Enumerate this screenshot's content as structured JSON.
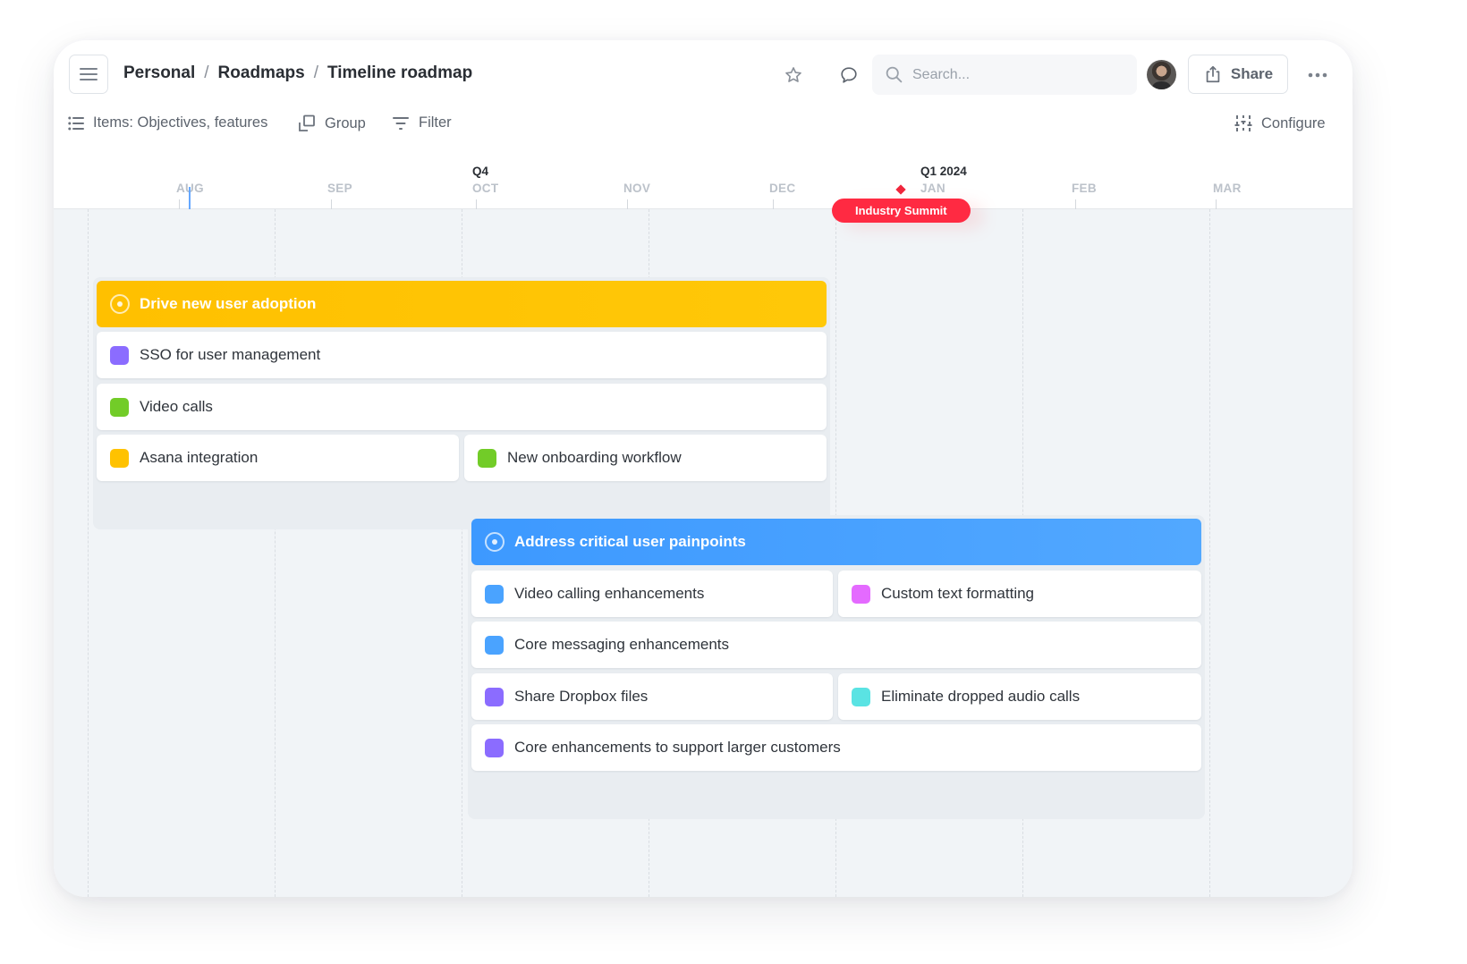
{
  "breadcrumb": [
    "Personal",
    "Roadmaps",
    "Timeline roadmap"
  ],
  "breadcrumb_separator": "/",
  "search": {
    "placeholder": "Search..."
  },
  "header": {
    "share_label": "Share"
  },
  "toolbar": {
    "items_label": "Items: Objectives, features",
    "group_label": "Group",
    "filter_label": "Filter",
    "configure_label": "Configure"
  },
  "timeline": {
    "quarters": [
      {
        "label": "Q4",
        "starts_at": "OCT"
      },
      {
        "label": "Q1 2024",
        "starts_at": "JAN"
      }
    ],
    "months": [
      "AUG",
      "SEP",
      "OCT",
      "NOV",
      "DEC",
      "JAN",
      "FEB",
      "MAR"
    ],
    "today_marker": "AUG",
    "milestones": [
      {
        "label": "Industry Summit",
        "color": "#ff2a42"
      }
    ]
  },
  "colors": {
    "objective_yellow": "#ffc200",
    "objective_blue": "#4aa3ff",
    "purple": "#8b6cff",
    "green": "#72cc28",
    "yellow": "#ffc200",
    "blue": "#4aa3ff",
    "magenta": "#e46aff",
    "cyan": "#5ae3e3"
  },
  "objectives": [
    {
      "title": "Drive new user adoption",
      "color": "#ffc200",
      "features": [
        {
          "title": "SSO for user management",
          "color": "#8b6cff"
        },
        {
          "title": "Video calls",
          "color": "#72cc28"
        },
        {
          "title": "Asana integration",
          "color": "#ffc200"
        },
        {
          "title": "New onboarding workflow",
          "color": "#72cc28"
        }
      ]
    },
    {
      "title": "Address critical user painpoints",
      "color": "#4aa3ff",
      "features": [
        {
          "title": "Video calling enhancements",
          "color": "#4aa3ff"
        },
        {
          "title": "Custom text formatting",
          "color": "#e46aff"
        },
        {
          "title": "Core messaging enhancements",
          "color": "#4aa3ff"
        },
        {
          "title": "Share Dropbox files",
          "color": "#8b6cff"
        },
        {
          "title": "Eliminate dropped audio calls",
          "color": "#5ae3e3"
        },
        {
          "title": "Core enhancements to support larger customers",
          "color": "#8b6cff"
        }
      ]
    }
  ]
}
